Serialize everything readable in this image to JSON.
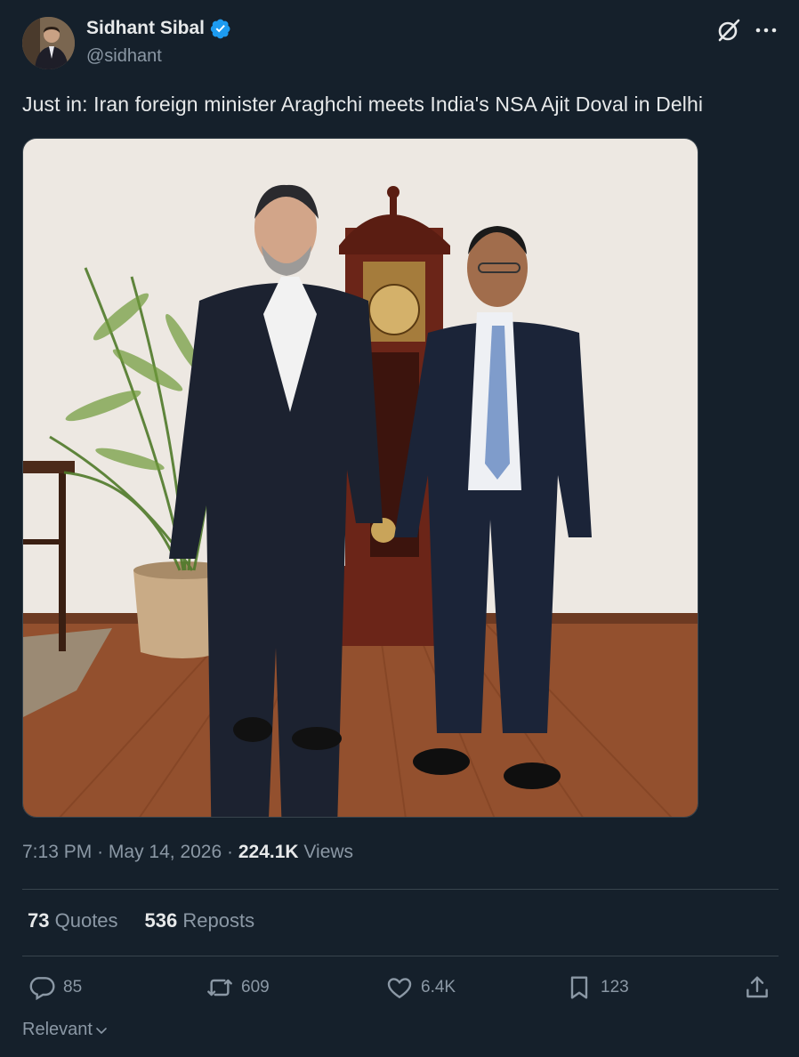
{
  "author": {
    "name": "Sidhant Sibal",
    "handle": "@sidhant"
  },
  "tweet": {
    "text": "Just in: Iran foreign minister Araghchi meets India's NSA Ajit Doval in Delhi"
  },
  "meta": {
    "time": "7:13 PM",
    "separator": "·",
    "date": "May 14, 2026",
    "views_count": "224.1K",
    "views_label": "Views"
  },
  "stats": {
    "quotes_count": "73",
    "quotes_label": "Quotes",
    "reposts_count": "536",
    "reposts_label": "Reposts"
  },
  "actions": {
    "replies": "85",
    "reposts": "609",
    "likes": "6.4K",
    "bookmarks": "123"
  },
  "sort": {
    "label": "Relevant"
  },
  "colors": {
    "background": "#15202b",
    "verified": "#1d9bf0",
    "muted": "#8b98a5",
    "text": "#e7e9ea"
  },
  "icons": [
    "verified-badge-icon",
    "grok-icon",
    "more-icon",
    "reply-icon",
    "repost-icon",
    "like-icon",
    "bookmark-icon",
    "share-icon",
    "chevron-down-icon"
  ]
}
